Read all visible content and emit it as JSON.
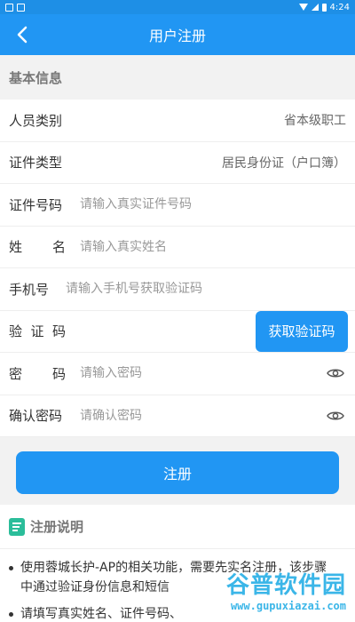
{
  "status": {
    "time": "4:24"
  },
  "nav": {
    "title": "用户注册",
    "back_icon": "chevron-left-icon"
  },
  "section_basic": "基本信息",
  "form": {
    "category": {
      "label": "人员类别",
      "value": "省本级职工"
    },
    "id_type": {
      "label": "证件类型",
      "value": "居民身份证（户口簿）"
    },
    "id_number": {
      "label": "证件号码",
      "placeholder": "请输入真实证件号码"
    },
    "name": {
      "label_a": "姓",
      "label_b": "名",
      "placeholder": "请输入真实姓名"
    },
    "phone": {
      "label": "手机号",
      "placeholder": "请输入手机号获取验证码"
    },
    "code": {
      "label_a": "验",
      "label_b": "证",
      "label_c": "码",
      "button": "获取验证码"
    },
    "password": {
      "label_a": "密",
      "label_b": "码",
      "placeholder": "请输入密码"
    },
    "confirm": {
      "label": "确认密码",
      "placeholder": "请确认密码"
    }
  },
  "submit_label": "注册",
  "notes": {
    "title": "注册说明",
    "items": [
      "使用蓉城长护-AP的相关功能，需要先实名注册，该步骤中通过验证身份信息和短信",
      "请填写真实姓名、证件号码、"
    ]
  },
  "watermark": {
    "text": "谷普软件园",
    "url": "www.gupuxiazai.com"
  },
  "colors": {
    "primary": "#2196f3",
    "status_bar": "#1e8fe6",
    "note_icon": "#2bbd9a"
  }
}
